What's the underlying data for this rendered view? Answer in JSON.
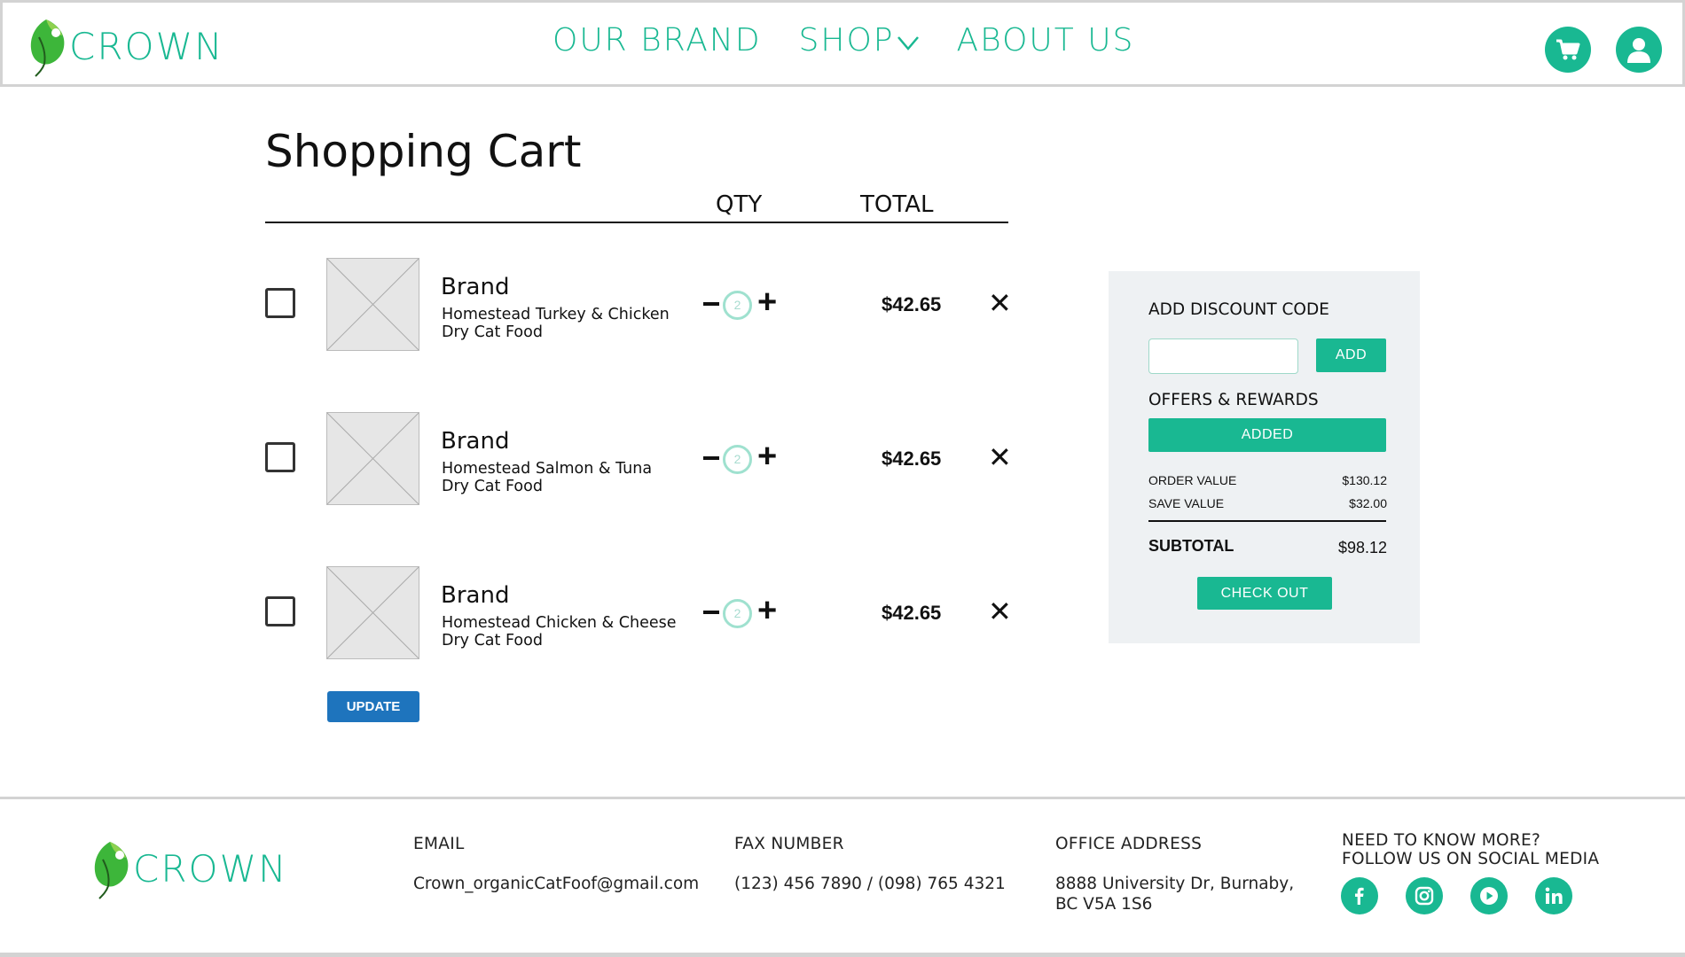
{
  "brand": {
    "name": "CROWN"
  },
  "nav": [
    {
      "label": "OUR BRAND"
    },
    {
      "label": "SHOP"
    },
    {
      "label": "ABOUT US"
    }
  ],
  "cart": {
    "title": "Shopping Cart",
    "columns": {
      "qty": "QTY",
      "total": "TOTAL"
    },
    "items": [
      {
        "brand": "Brand",
        "name": "Homestead Turkey & Chicken Dry Cat Food",
        "qty": "2",
        "total": "$42.65"
      },
      {
        "brand": "Brand",
        "name": "Homestead Salmon & Tuna Dry Cat Food",
        "qty": "2",
        "total": "$42.65"
      },
      {
        "brand": "Brand",
        "name": "Homestead Chicken & Cheese Dry Cat Food",
        "qty": "2",
        "total": "$42.65"
      }
    ],
    "update_label": "UPDATE"
  },
  "summary": {
    "discount_heading": "ADD DISCOUNT CODE",
    "discount_value": "",
    "add_label": "ADD",
    "offers_heading": "OFFERS & REWARDS",
    "added_label": "ADDED",
    "order_value_label": "ORDER VALUE",
    "order_value": "$130.12",
    "save_value_label": "SAVE VALUE",
    "save_value": "$32.00",
    "subtotal_label": "SUBTOTAL",
    "subtotal": "$98.12",
    "checkout_label": "CHECK OUT"
  },
  "footer": {
    "email_heading": "EMAIL",
    "email": "Crown_organicCatFoof@gmail.com",
    "fax_heading": "FAX NUMBER",
    "fax": "(123) 456 7890 / (098) 765 4321",
    "office_heading": "OFFICE ADDRESS",
    "office_line1": "8888 University Dr, Burnaby,",
    "office_line2": "BC V5A 1S6",
    "social_line1": "NEED TO KNOW MORE?",
    "social_line2": "FOLLOW US ON SOCIAL MEDIA",
    "social": [
      "facebook-icon",
      "instagram-icon",
      "youtube-icon",
      "linkedin-icon"
    ]
  },
  "colors": {
    "accent": "#19b892",
    "update": "#1e74bd",
    "panel": "#eef1f3"
  }
}
